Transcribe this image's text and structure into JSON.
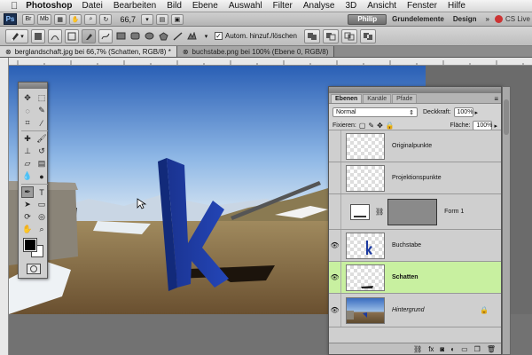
{
  "menubar": {
    "app": "Photoshop",
    "items": [
      "Datei",
      "Bearbeiten",
      "Bild",
      "Ebene",
      "Auswahl",
      "Filter",
      "Analyse",
      "3D",
      "Ansicht",
      "Fenster",
      "Hilfe"
    ]
  },
  "appbar": {
    "logo": "Ps",
    "zoom": "66,7",
    "workspace_active": "Philip",
    "workspace_items": [
      "Grundelemente",
      "Design"
    ],
    "more": "»",
    "cs_live": "CS Live"
  },
  "options": {
    "auto_add_delete_label": "Autom. hinzuf./löschen",
    "auto_add_delete_checked": true
  },
  "tabs": [
    {
      "label": "berglandschaft.jpg bei 66,7% (Schatten, RGB/8) *",
      "active": true
    },
    {
      "label": "buchstabe.png bei 100% (Ebene 0, RGB/8)",
      "active": false
    }
  ],
  "layers_panel": {
    "tabs": [
      "Ebenen",
      "Kanäle",
      "Pfade"
    ],
    "active_tab": "Ebenen",
    "blend_mode": "Normal",
    "opacity_label": "Deckkraft:",
    "opacity_value": "100%",
    "lock_label": "Fixieren:",
    "fill_label": "Fläche:",
    "fill_value": "100%",
    "layers": [
      {
        "name": "Originalpunkte",
        "visible": false,
        "selected": false,
        "italic": false
      },
      {
        "name": "Projektionspunkte",
        "visible": false,
        "selected": false,
        "italic": false
      },
      {
        "name": "Form 1",
        "visible": false,
        "selected": false,
        "italic": false
      },
      {
        "name": "Buchstabe",
        "visible": true,
        "selected": false,
        "italic": false
      },
      {
        "name": "Schatten",
        "visible": true,
        "selected": true,
        "italic": false
      },
      {
        "name": "Hintergrund",
        "visible": true,
        "selected": false,
        "italic": true
      }
    ]
  },
  "colors": {
    "selected_layer": "#c8f0a0",
    "letter_blue": "#1c3aa0",
    "sky_top": "#2a5fb5"
  }
}
